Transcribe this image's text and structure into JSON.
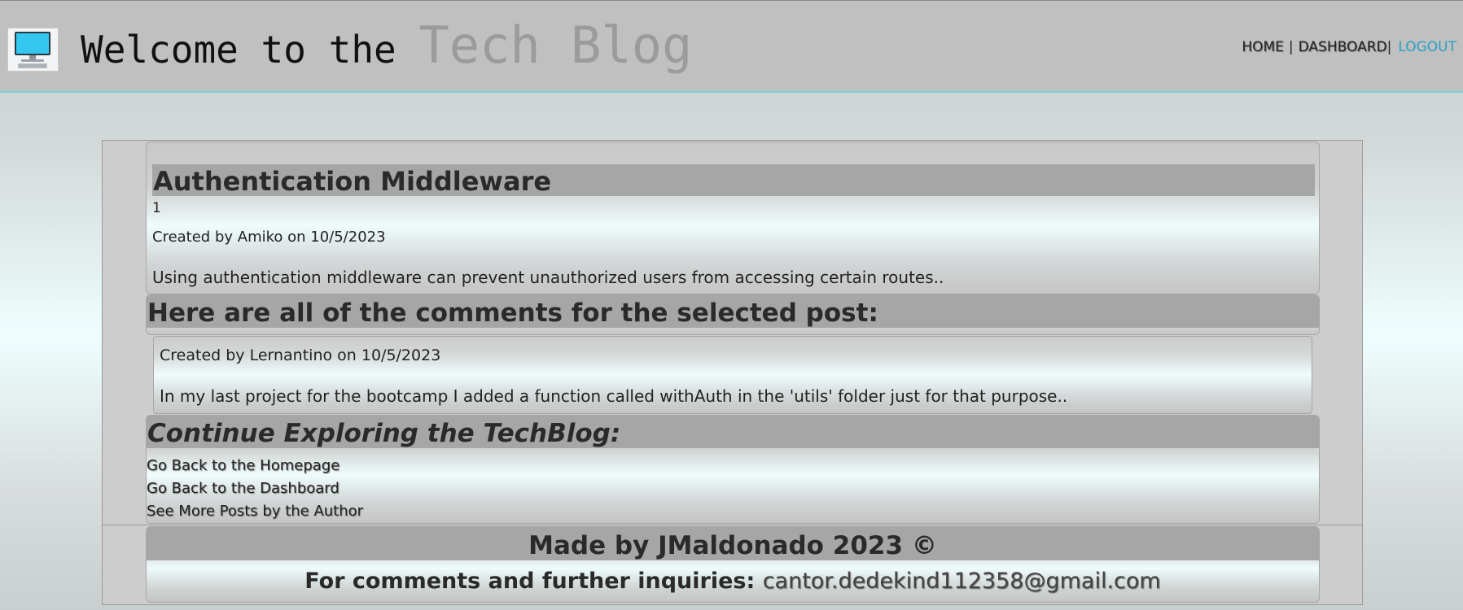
{
  "header": {
    "title_part1": "Welcome to the ",
    "title_part2": "Tech Blog",
    "logo_icon": "computer-monitor-icon",
    "nav": {
      "home": "HOME",
      "separator": "|",
      "dashboard": "DASHBOARD",
      "logout": "LOGOUT"
    }
  },
  "post": {
    "title": "Authentication Middleware",
    "id": "1",
    "meta": "Created by Amiko on 10/5/2023",
    "body": "Using authentication middleware can prevent unauthorized users from accessing certain routes.."
  },
  "comments": {
    "heading": "Here are all of the comments for the selected post:",
    "items": [
      {
        "meta": "Created by Lernantino on 10/5/2023",
        "body": "In my last project for the bootcamp I added a function called withAuth in the 'utils' folder just for that purpose.."
      }
    ]
  },
  "explore": {
    "heading": "Continue Exploring the TechBlog:",
    "links": [
      "Go Back to the Homepage",
      "Go Back to the Dashboard",
      "See More Posts by the Author"
    ]
  },
  "footer": {
    "made_by": "Made by JMaldonado 2023 ©",
    "contact_label": "For comments and further inquiries: ",
    "email": "cantor.dedekind112358@gmail.com"
  },
  "colors": {
    "accent_link": "#2aa0c7",
    "header_bg": "#c0c0c0",
    "section_bar": "#a6a6a6"
  }
}
